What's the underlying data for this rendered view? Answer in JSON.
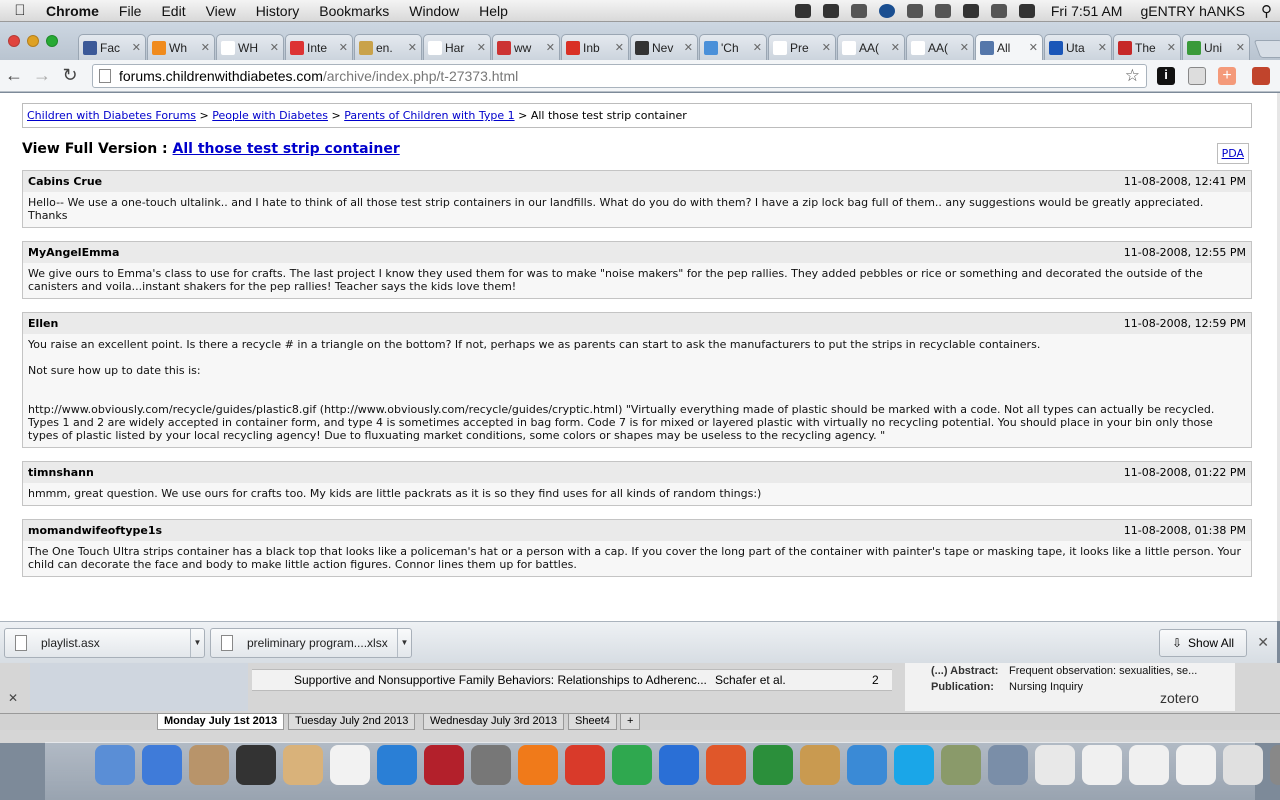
{
  "menubar": {
    "app_name": "Chrome",
    "menus": [
      "File",
      "Edit",
      "View",
      "History",
      "Bookmarks",
      "Window",
      "Help"
    ],
    "clock": "Fri 7:51 AM",
    "user": "gENTRY hANKS"
  },
  "tabs": [
    {
      "title": "Fac",
      "color": "#3b5998"
    },
    {
      "title": "Wh",
      "color": "#f08b1d"
    },
    {
      "title": "WH",
      "color": "#ffffff"
    },
    {
      "title": "Inte",
      "color": "#d33"
    },
    {
      "title": "en.",
      "color": "#c9a24a"
    },
    {
      "title": "Har",
      "color": "#ffffff"
    },
    {
      "title": "ww",
      "color": "#c33"
    },
    {
      "title": "Inb",
      "color": "#d93025"
    },
    {
      "title": "Nev",
      "color": "#333333"
    },
    {
      "title": "'Ch",
      "color": "#4a90d9"
    },
    {
      "title": "Pre",
      "color": "#ffffff"
    },
    {
      "title": "AA(",
      "color": "#ffffff"
    },
    {
      "title": "AA(",
      "color": "#ffffff"
    },
    {
      "title": "All",
      "color": "#5577aa",
      "active": true
    },
    {
      "title": "Uta",
      "color": "#1a56b8"
    },
    {
      "title": "The",
      "color": "#c62828"
    },
    {
      "title": "Uni",
      "color": "#3a9a3a"
    }
  ],
  "toolbar": {
    "url_host": "forums.childrenwithdiabetes.com",
    "url_path": "/archive/index.php/t-27373.html"
  },
  "page": {
    "breadcrumb": {
      "crumb1": "Children with Diabetes Forums",
      "crumb2": "People with Diabetes",
      "crumb3": "Parents of Children with Type 1",
      "current": "All those test strip container",
      "sep": " > "
    },
    "pda_link": "PDA",
    "full_version_label": "View Full Version : ",
    "full_version_link": "All those test strip container",
    "posts": [
      {
        "author": "Cabins Crue",
        "date": "11-08-2008, 12:41 PM",
        "paragraphs": [
          "Hello-- We use a one-touch ultalink.. and I hate to think of all those test strip containers in our landfills. What do you do with them? I have a zip lock bag full of them.. any suggestions would be greatly appreciated. Thanks"
        ]
      },
      {
        "author": "MyAngelEmma",
        "date": "11-08-2008, 12:55 PM",
        "paragraphs": [
          "We give ours to Emma's class to use for crafts. The last project I know they used them for was to make \"noise makers\" for the pep rallies. They added pebbles or rice or something and decorated the outside of the canisters and voila...instant shakers for the pep rallies! Teacher says the kids love them!"
        ]
      },
      {
        "author": "Ellen",
        "date": "11-08-2008, 12:59 PM",
        "paragraphs": [
          "You raise an excellent point. Is there a recycle # in a triangle on the bottom? If not, perhaps we as parents can start to ask the manufacturers to put the strips in recyclable containers.",
          "Not sure how up to date this is:",
          "http://www.obviously.com/recycle/guides/plastic8.gif (http://www.obviously.com/recycle/guides/cryptic.html) \"Virtually everything made of plastic should be marked with a code. Not all types can actually be recycled. Types 1 and 2 are widely accepted in container form, and type 4 is sometimes accepted in bag form. Code 7 is for mixed or layered plastic with virtually no recycling potential. You should place in your bin only those types of plastic listed by your local recycling agency! Due to fluxuating market conditions, some colors or shapes may be useless to the recycling agency. \""
        ]
      },
      {
        "author": "timnshann",
        "date": "11-08-2008, 01:22 PM",
        "paragraphs": [
          "hmmm, great question. We use ours for crafts too. My kids are little packrats as it is so they find uses for all kinds of random things:)"
        ]
      },
      {
        "author": "momandwifeoftype1s",
        "date": "11-08-2008, 01:38 PM",
        "paragraphs": [
          "The One Touch Ultra strips container has a black top that looks like a policeman's hat or a person with a cap. If you cover the long part of the container with painter's tape or masking tape, it looks like a little person. Your child can decorate the face and body to make little action figures. Connor lines them up for battles."
        ]
      }
    ]
  },
  "downloads": {
    "item1": "playlist.asx",
    "item2": "preliminary program....xlsx",
    "show_all": "Show All"
  },
  "behind": {
    "row_title": "Supportive and Nonsupportive Family Behaviors: Relationships to Adherenc...",
    "row_author": "Schafer et al.",
    "row_num": "2",
    "abstract_key": "(...) Abstract:",
    "abstract_val": "Frequent observation: sexualities, se...",
    "pub_key": "Publication:",
    "pub_val": "Nursing Inquiry",
    "brand": "zotero",
    "sheets": [
      "Monday July 1st 2013",
      "Tuesday July 2nd 2013",
      "Wednesday July 3rd 2013",
      "Sheet4",
      "+"
    ]
  },
  "dock_colors": [
    "#5a8ed6",
    "#3f7bd9",
    "#b8946a",
    "#333",
    "#d9b27a",
    "#f2f2f2",
    "#2a7fd6",
    "#b3202b",
    "#777",
    "#f07a1a",
    "#d93a2a",
    "#2fa84f",
    "#2a6fd6",
    "#e0572a",
    "#2b8f3b",
    "#c99a50",
    "#3a8ad6",
    "#1aa6e8",
    "#8a9a6a",
    "#7a8ea8",
    "#e8e8e8",
    "#f0f0f0",
    "#f0f0f0",
    "#f0f0f0",
    "#e0e0e0",
    "#888"
  ]
}
